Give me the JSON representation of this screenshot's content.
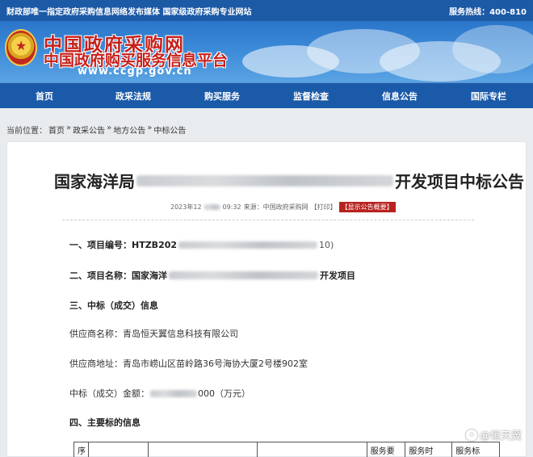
{
  "topbar": {
    "left_text": "财政部唯一指定政府采购信息网络发布媒体 国家级政府采购专业网站",
    "hotline": "服务热线：400-810"
  },
  "header": {
    "title": "中国政府采购网",
    "subtitle": "中国政府购买服务信息平台",
    "url": "www.ccgp.gov.cn"
  },
  "nav": {
    "items": [
      "首页",
      "政采法规",
      "购买服务",
      "监督检查",
      "信息公告",
      "国际专栏"
    ]
  },
  "breadcrumb": {
    "label": "当前位置：",
    "items": [
      "首页",
      "政采公告",
      "地方公告",
      "中标公告"
    ],
    "separator": "»"
  },
  "article": {
    "title_prefix": "国家海洋局",
    "title_suffix": "开发项目中标公告",
    "meta_date_prefix": "2023年12",
    "meta_time": "09:32",
    "meta_source": "来源：中国政府采购网",
    "meta_print": "【打印】",
    "meta_badge": "【显示公告概要】",
    "item1_label": "一、项目编号：",
    "item1_value_prefix": "HTZB202",
    "item1_value_suffix": "10)",
    "item2_label": "二、项目名称：",
    "item2_value_prefix": "国家海洋",
    "item2_value_suffix": "开发项目",
    "item3_label": "三、中标（成交）信息",
    "supplier_name_label": "供应商名称：",
    "supplier_name": "青岛恒天翼信息科技有限公司",
    "supplier_addr_label": "供应商地址：",
    "supplier_addr": "青岛市崂山区苗岭路36号海协大厦2号楼902室",
    "amount_label": "中标（成交）金额：",
    "amount_suffix": "000（万元）",
    "item4_label": "四、主要标的信息",
    "table_headers": [
      "序",
      "",
      "",
      "",
      "服务要",
      "服务时",
      "服务标"
    ]
  },
  "watermark": {
    "text": "@恒天翼"
  },
  "colors": {
    "topbar_bg": "#1d5aa6",
    "nav_bg": "#1b5aa8",
    "title_red": "#c8201a",
    "badge_red": "#b8231f"
  }
}
